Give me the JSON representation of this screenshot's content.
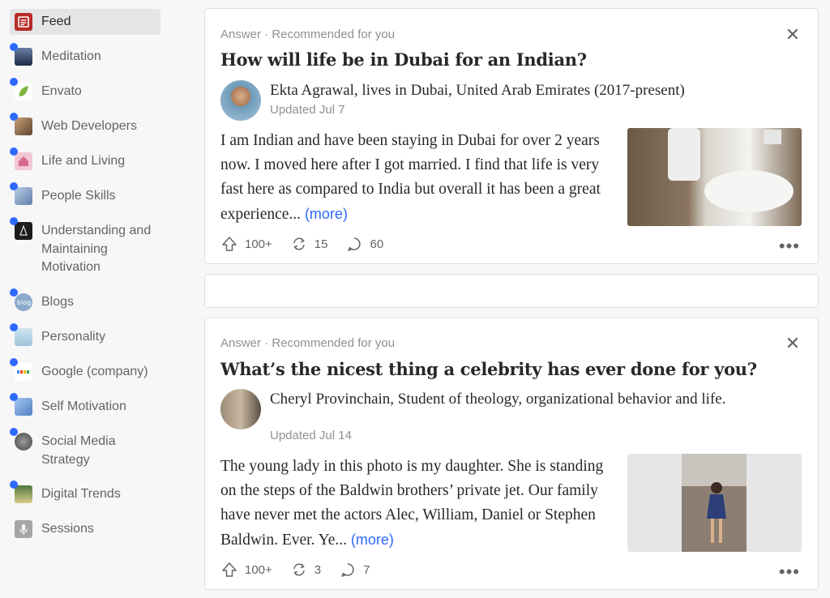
{
  "sidebar": {
    "items": [
      {
        "label": "Feed",
        "icon": "feed-icon",
        "color": "#b92b27"
      },
      {
        "label": "Meditation",
        "icon": "meditation-icon",
        "color": "#3b4a6b"
      },
      {
        "label": "Envato",
        "icon": "envato-leaf-icon",
        "color": "#82b541"
      },
      {
        "label": "Web Developers",
        "icon": "web-developers-icon",
        "color": "#8a6a4a"
      },
      {
        "label": "Life and Living",
        "icon": "life-living-icon",
        "color": "#d46a8c"
      },
      {
        "label": "People Skills",
        "icon": "people-skills-icon",
        "color": "#6f8db4"
      },
      {
        "label": "Understanding and Maintaining Motivation",
        "icon": "motivation-icon",
        "color": "#1c1c1c"
      },
      {
        "label": "Blogs",
        "icon": "blogs-icon",
        "color": "#6b8fb5"
      },
      {
        "label": "Personality",
        "icon": "personality-icon",
        "color": "#9cc4d9"
      },
      {
        "label": "Google (company)",
        "icon": "google-icon",
        "color": "#ffffff"
      },
      {
        "label": "Self Motivation",
        "icon": "self-motivation-icon",
        "color": "#6a9ad4"
      },
      {
        "label": "Social Media Strategy",
        "icon": "social-media-icon",
        "color": "#7a7a7a"
      },
      {
        "label": "Digital Trends",
        "icon": "digital-trends-icon",
        "color": "#5c8a4c"
      },
      {
        "label": "Sessions",
        "icon": "microphone-icon",
        "color": "#a5a6a8"
      }
    ]
  },
  "cards": [
    {
      "meta": "Answer · Recommended for you",
      "title": "How will life be in Dubai for an Indian?",
      "author": "Ekta Agrawal, lives in Dubai, United Arab Emirates (2017-present)",
      "updated": "Updated Jul 7",
      "body": "I am Indian and have been staying in Dubai for over 2 years now. I moved here after I got married. I find that life is very fast here as compared to India but overall it has been a great experience...",
      "more": "(more)",
      "upvotes": "100+",
      "shares": "15",
      "comments": "60"
    },
    {
      "meta": "Answer · Recommended for you",
      "title": "What’s the nicest thing a celebrity has ever done for you?",
      "author": "Cheryl Provinchain, Student of theology, organizational behavior and life.",
      "updated": "Updated Jul 14",
      "body": "The young lady in this photo is my daughter. She is standing on the steps of the Baldwin brothers’ private jet. Our family have never met the actors Alec, William, Daniel or Stephen Baldwin. Ever. Ye...",
      "more": "(more)",
      "upvotes": "100+",
      "shares": "3",
      "comments": "7"
    }
  ],
  "colors": {
    "accent": "#2e69ff",
    "brand": "#b92b27",
    "text": "#282829",
    "muted": "#636466"
  }
}
